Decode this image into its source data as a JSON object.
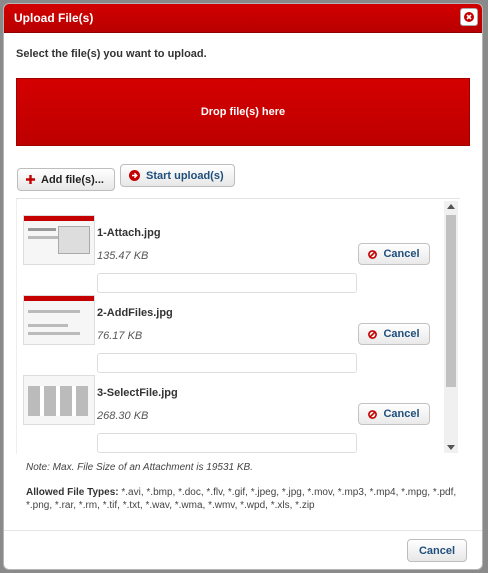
{
  "dialog": {
    "title": "Upload File(s)",
    "instruction": "Select the file(s) you want to upload.",
    "dropzone_label": "Drop file(s) here"
  },
  "toolbar": {
    "add_label": "Add file(s)...",
    "start_label": "Start upload(s)"
  },
  "files": [
    {
      "name": "1-Attach.jpg",
      "size": "135.47 KB",
      "cancel_label": "Cancel"
    },
    {
      "name": "2-AddFiles.jpg",
      "size": "76.17 KB",
      "cancel_label": "Cancel"
    },
    {
      "name": "3-SelectFile.jpg",
      "size": "268.30 KB",
      "cancel_label": "Cancel"
    }
  ],
  "note": "Note: Max. File Size of an Attachment is 19531 KB.",
  "allowed": {
    "label": "Allowed File Types:",
    "types": "*.avi, *.bmp, *.doc, *.flv, *.gif, *.jpeg, *.jpg, *.mov, *.mp3, *.mp4, *.mpg, *.pdf, *.png, *.rar, *.rm, *.tif, *.txt, *.wav, *.wma, *.wmv, *.wpd, *.xls, *.zip"
  },
  "footer": {
    "cancel_label": "Cancel"
  },
  "colors": {
    "brand_red": "#c40000",
    "button_text_blue": "#1f4f7c"
  },
  "icons": {
    "close": "close-icon",
    "add": "plus-icon",
    "start": "circle-arrow-right-icon",
    "cancel": "ban-icon"
  }
}
